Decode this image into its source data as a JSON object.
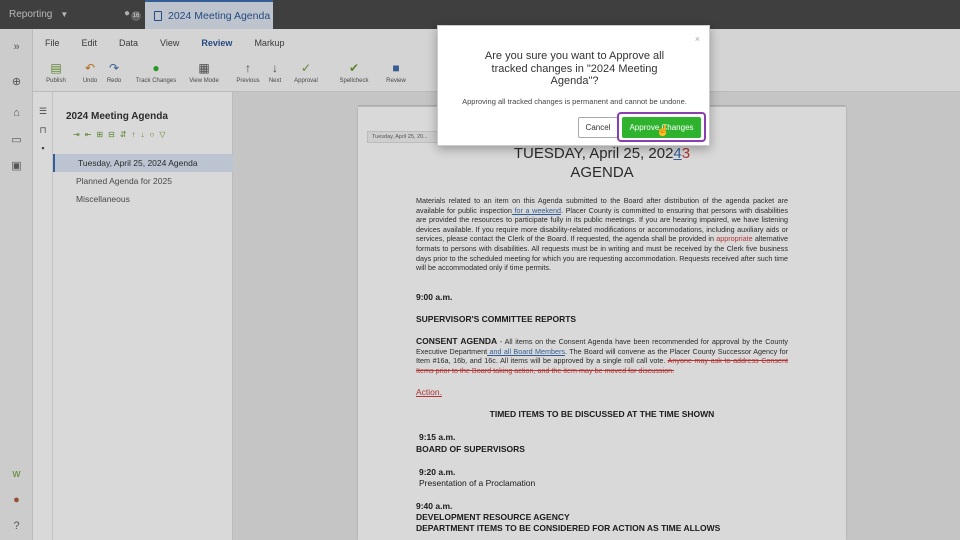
{
  "topbar": {
    "product": "Reporting",
    "users_count": "16",
    "doc_tab": "2024 Meeting Agenda"
  },
  "ribbon": {
    "menu": [
      "File",
      "Edit",
      "Data",
      "View",
      "Review",
      "Markup"
    ],
    "buttons": {
      "publish": "Publish",
      "undo": "Undo",
      "redo": "Redo",
      "track": "Track Changes",
      "view_mode": "View Mode",
      "previous": "Previous",
      "next": "Next",
      "approval": "Approval",
      "spellcheck": "Spellcheck",
      "review": "Review"
    }
  },
  "panel": {
    "title": "2024 Meeting Agenda",
    "items": [
      "Tuesday, April 25, 2024 Agenda",
      "Planned Agenda for 2025",
      "Miscellaneous"
    ]
  },
  "document": {
    "page_tab": "Tuesday, April 25, 20...",
    "heading_date": "TUESDAY, April 25, 202",
    "heading_ins": "4",
    "heading_del": "3",
    "heading_2": "AGENDA",
    "intro_a": "Materials related to an item on this Agenda submitted to the Board after distribution of the agenda packet are available for public inspection",
    "intro_ins": " for a weekend",
    "intro_b": ". Placer County is committed to ensuring that persons with disabilities are provided the resources to participate fully in its public meetings. If you are hearing impaired, we have listening devices available. If you require more disability-related modifications or accommodations, including auxiliary aids or services, please contact the Clerk of the Board. If requested, the agenda shall be provided in ",
    "intro_red": "appropriate",
    "intro_c": " alternative formats to persons with disabilities. All requests must be in writing and must be received by the Clerk five business days prior to the scheduled meeting for which you are requesting accommodation. Requests received after such time will be accommodated only if time permits.",
    "time1": "9:00 a.m.",
    "supervisor": "SUPERVISOR'S COMMITTEE REPORTS",
    "consent_h": "CONSENT AGENDA",
    "consent_a": " - All items on the Consent Agenda have been recommended for approval by the County Executive Department",
    "consent_ins": " and all Board Members",
    "consent_b": ". The Board will convene as the Placer County Successor Agency for Item #16a, 16b, and 16c. All items will be approved by a single roll call vote. ",
    "consent_del": "Anyone may ask to address Consent Items prior to the Board taking action, and the item may be moved for discussion.",
    "action": "Action.",
    "timed": "TIMED ITEMS TO BE DISCUSSED AT THE TIME SHOWN",
    "t915": "9:15 a.m.",
    "bos": "BOARD OF SUPERVISORS",
    "t920": "9:20 a.m.",
    "procl": "Presentation of a Proclamation",
    "t940": "9:40 a.m.",
    "dra": "DEVELOPMENT RESOURCE AGENCY",
    "dept": "DEPARTMENT ITEMS TO BE CONSIDERED FOR ACTION AS TIME ALLOWS"
  },
  "dialog": {
    "title": "Are you sure you want to Approve all tracked changes in \"2024 Meeting Agenda\"?",
    "message": "Approving all tracked changes is permanent and cannot be undone.",
    "cancel": "Cancel",
    "approve": "Approve Changes",
    "close": "×"
  },
  "colors": {
    "accent": "#2b5797",
    "approve": "#2fb32f",
    "highlight": "#8a3fb0",
    "deleted": "#d04040"
  }
}
